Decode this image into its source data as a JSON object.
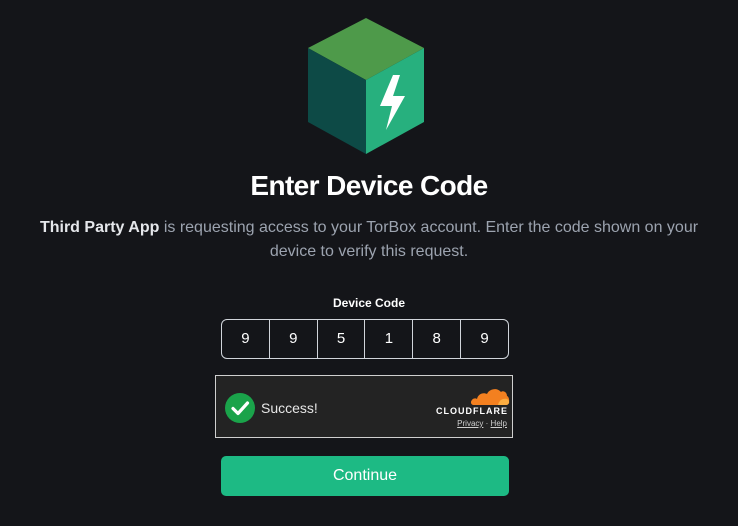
{
  "heading": {
    "title": "Enter Device Code"
  },
  "description": {
    "app_name": "Third Party App",
    "text": " is requesting access to your TorBox account. Enter the code shown on your device to verify this request."
  },
  "device_code": {
    "label": "Device Code",
    "digits": [
      "9",
      "9",
      "5",
      "1",
      "8",
      "9"
    ]
  },
  "captcha": {
    "status": "Success!",
    "brand": "CLOUDFLARE",
    "privacy_label": "Privacy",
    "separator": "·",
    "help_label": "Help",
    "icon": "check-circle-icon"
  },
  "actions": {
    "continue_label": "Continue"
  },
  "colors": {
    "background": "#141519",
    "accent": "#1dba84",
    "cloudflare_orange": "#f38020"
  }
}
